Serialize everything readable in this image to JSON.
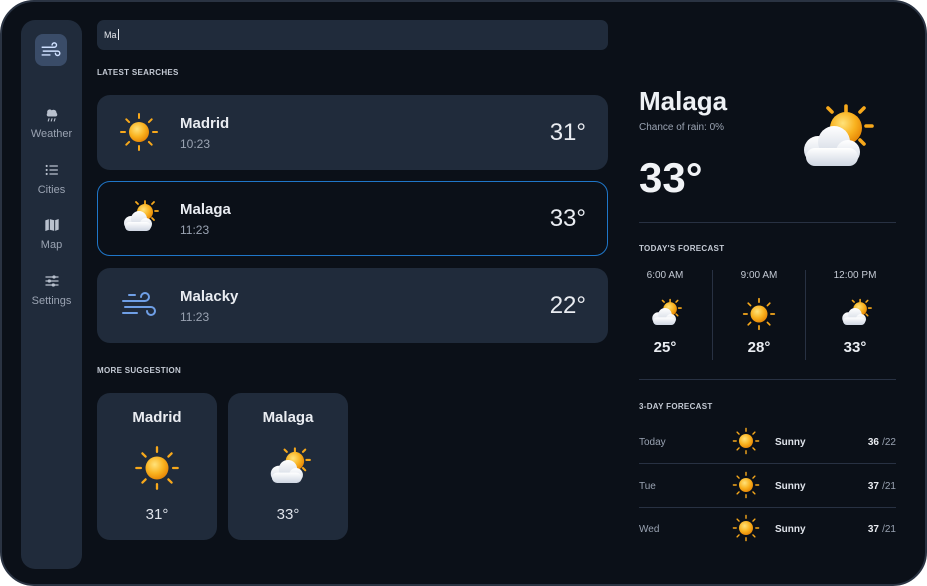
{
  "search": {
    "value": "Ma"
  },
  "sidebar": {
    "items": [
      {
        "label": "Weather",
        "icon": "cloud-rain-icon"
      },
      {
        "label": "Cities",
        "icon": "list-icon"
      },
      {
        "label": "Map",
        "icon": "map-icon"
      },
      {
        "label": "Settings",
        "icon": "sliders-icon"
      }
    ]
  },
  "latest": {
    "title": "LATEST SEARCHES",
    "items": [
      {
        "city": "Madrid",
        "time": "10:23",
        "temp": "31°",
        "icon": "sun-icon"
      },
      {
        "city": "Malaga",
        "time": "11:23",
        "temp": "33°",
        "icon": "partly-cloudy-icon"
      },
      {
        "city": "Malacky",
        "time": "11:23",
        "temp": "22°",
        "icon": "wind-icon"
      }
    ]
  },
  "suggestions": {
    "title": "MORE SUGGESTION",
    "items": [
      {
        "city": "Madrid",
        "temp": "31°",
        "icon": "sun-icon"
      },
      {
        "city": "Malaga",
        "temp": "33°",
        "icon": "partly-cloudy-icon"
      }
    ]
  },
  "current": {
    "city": "Malaga",
    "rain": "Chance of rain: 0%",
    "temp": "33°",
    "icon": "partly-cloudy-icon"
  },
  "today": {
    "title": "TODAY'S FORECAST",
    "hours": [
      {
        "time": "6:00 AM",
        "temp": "25°",
        "icon": "partly-cloudy-icon"
      },
      {
        "time": "9:00 AM",
        "temp": "28°",
        "icon": "sun-icon"
      },
      {
        "time": "12:00 PM",
        "temp": "33°",
        "icon": "partly-cloudy-icon"
      }
    ]
  },
  "three_day": {
    "title": "3-DAY FORECAST",
    "days": [
      {
        "day": "Today",
        "cond": "Sunny",
        "hi": "36",
        "lo": "/22",
        "icon": "sun-icon"
      },
      {
        "day": "Tue",
        "cond": "Sunny",
        "hi": "37",
        "lo": "/21",
        "icon": "sun-icon"
      },
      {
        "day": "Wed",
        "cond": "Sunny",
        "hi": "37",
        "lo": "/21",
        "icon": "sun-icon"
      }
    ]
  },
  "colors": {
    "background": "#0b1018",
    "card": "#202b3b",
    "accent": "#1f76c8",
    "sun": "#f7a81b"
  }
}
